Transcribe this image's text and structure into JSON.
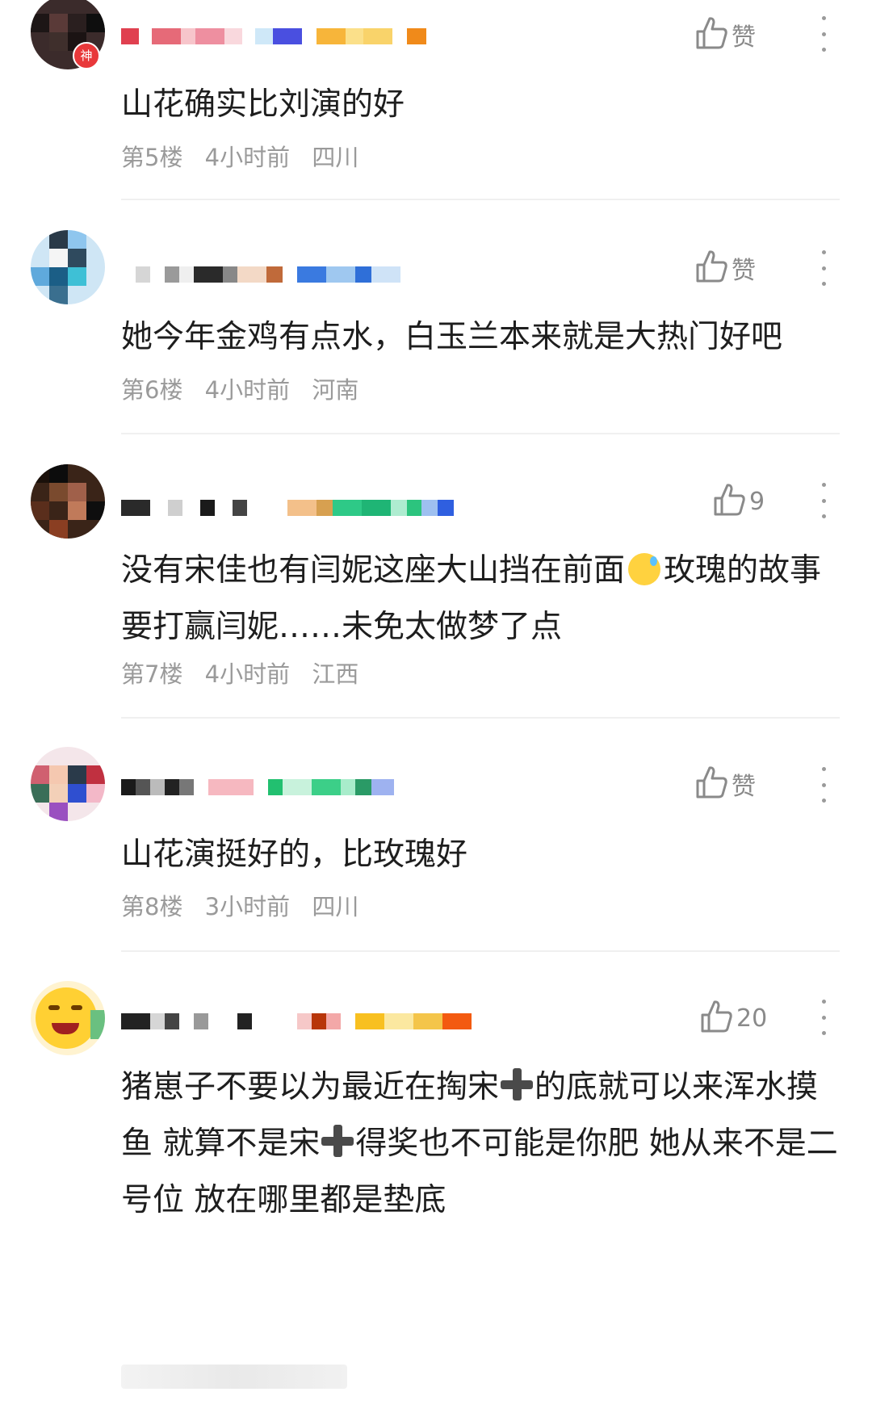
{
  "comments": [
    {
      "avatar_badge": "神",
      "like_label": "赞",
      "text": "山花确实比刘演的好",
      "floor": "第5楼",
      "time": "4小时前",
      "location": "四川"
    },
    {
      "like_label": "赞",
      "text": "她今年金鸡有点水，白玉兰本来就是大热门好吧",
      "floor": "第6楼",
      "time": "4小时前",
      "location": "河南"
    },
    {
      "like_label": "9",
      "text_part1": "没有宋佳也有闫妮这座大山挡在前面",
      "text_part2": "玫瑰的故事要打赢闫妮……未免太做梦了点",
      "floor": "第7楼",
      "time": "4小时前",
      "location": "江西"
    },
    {
      "like_label": "赞",
      "text": "山花演挺好的，比玫瑰好",
      "floor": "第8楼",
      "time": "3小时前",
      "location": "四川"
    },
    {
      "like_label": "20",
      "text_part1": "猪崽子不要以为最近在掏宋",
      "text_part2": "的底就可以来浑水摸鱼 就算不是宋",
      "text_part3": "得奖也不可能是你肥 她从来不是二号位 放在哪里都是垫底"
    }
  ],
  "icons": {
    "like": "thumbs-up-icon",
    "more": "more-vertical-icon",
    "emoji": "sweat-smile-emoji-icon",
    "plus": "heavy-plus-icon"
  },
  "colors": {
    "meta_text": "#9a9a9a",
    "badge_red": "#e8383a"
  }
}
